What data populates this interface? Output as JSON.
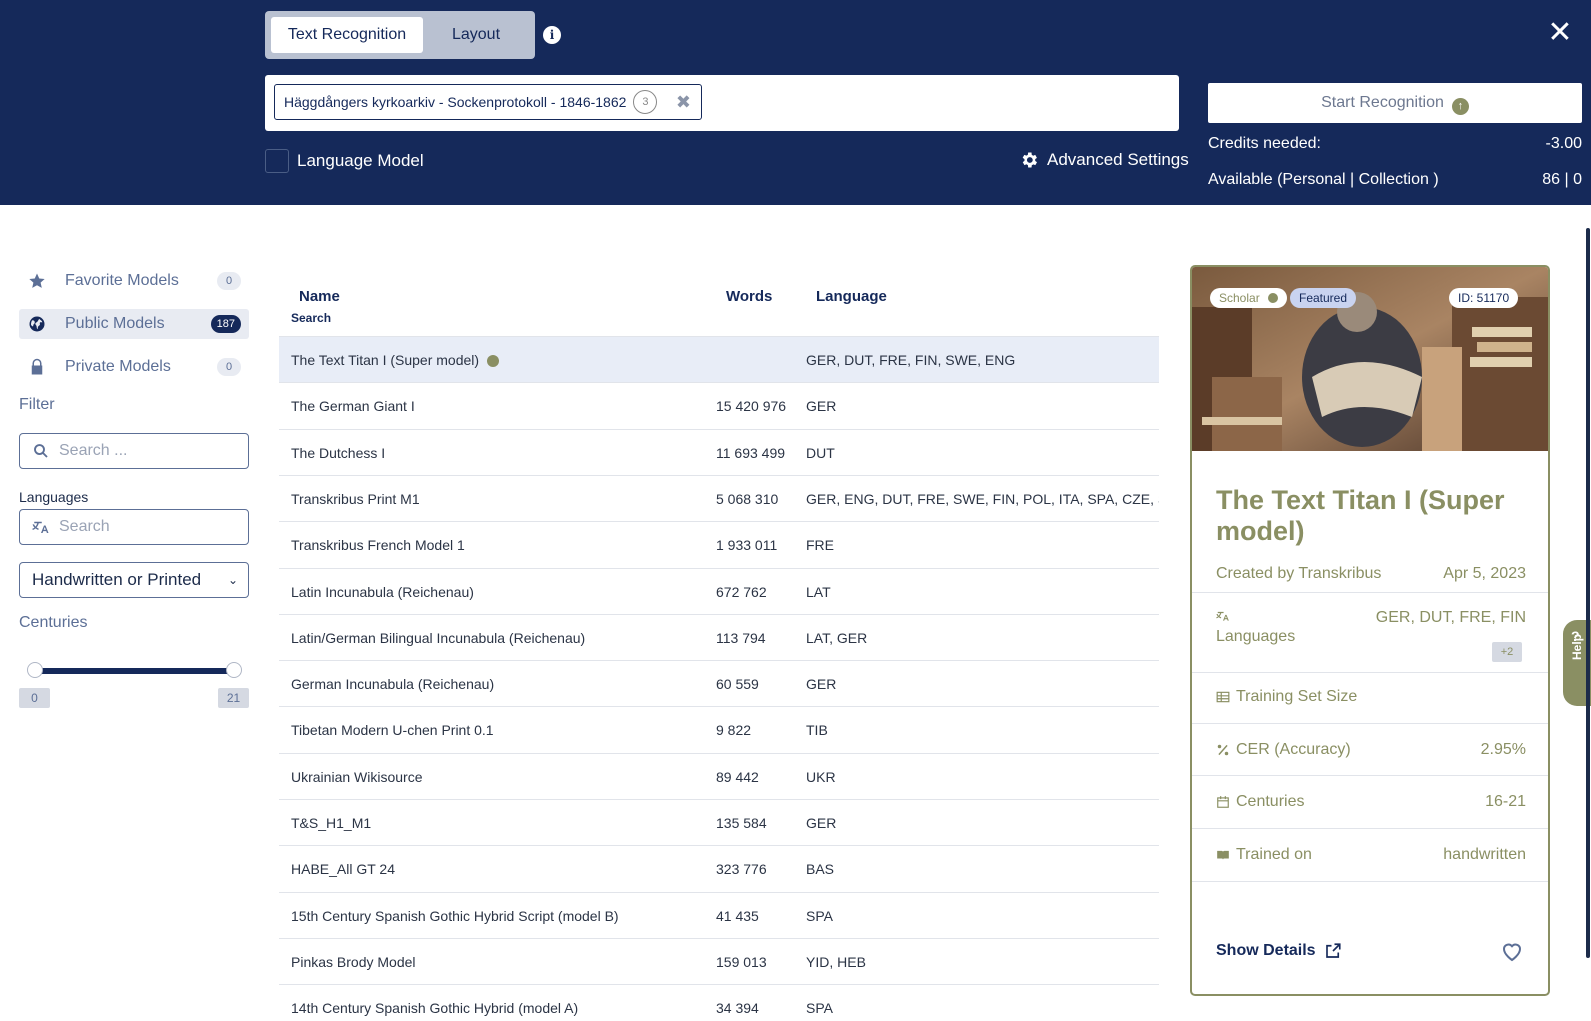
{
  "header": {
    "tabs": [
      {
        "label": "Text Recognition",
        "active": true
      },
      {
        "label": "Layout",
        "active": false
      }
    ],
    "document": {
      "name": "Häggdångers kyrkoarkiv - Sockenprotokoll - 1846-1862",
      "count": "3"
    },
    "language_model_label": "Language Model",
    "advanced_settings_label": "Advanced Settings",
    "start_label": "Start Recognition",
    "credits": {
      "needed_label": "Credits needed:",
      "needed_value": "-3.00",
      "available_label": "Available (Personal | Collection )",
      "available_value": "86 | 0"
    }
  },
  "sidebar": {
    "items": [
      {
        "label": "Favorite Models",
        "count": "0",
        "icon": "star-icon"
      },
      {
        "label": "Public Models",
        "count": "187",
        "icon": "globe-icon"
      },
      {
        "label": "Private Models",
        "count": "0",
        "icon": "lock-icon"
      }
    ],
    "filter_label": "Filter",
    "search_placeholder": "Search ...",
    "languages_label": "Languages",
    "languages_placeholder": "Search",
    "type_select": "Handwritten or Printed",
    "centuries_label": "Centuries",
    "centuries_range": {
      "min": "0",
      "max": "21"
    }
  },
  "table": {
    "headers": {
      "name": "Name",
      "name_sub": "Search",
      "words": "Words",
      "language": "Language"
    },
    "rows": [
      {
        "name": "The Text Titan I (Super model)",
        "words": "",
        "lang": "GER, DUT, FRE, FIN, SWE, ENG"
      },
      {
        "name": "The German Giant I",
        "words": "15 420 976",
        "lang": "GER"
      },
      {
        "name": "The Dutchess I",
        "words": "11 693 499",
        "lang": "DUT"
      },
      {
        "name": "Transkribus Print M1",
        "words": "5 068 310",
        "lang": "GER, ENG, DUT, FRE, SWE, FIN, POL, ITA, SPA, CZE, SLO, SL"
      },
      {
        "name": "Transkribus French Model 1",
        "words": "1 933 011",
        "lang": "FRE"
      },
      {
        "name": "Latin Incunabula (Reichenau)",
        "words": "672 762",
        "lang": "LAT"
      },
      {
        "name": "Latin/German Bilingual Incunabula (Reichenau)",
        "words": "113 794",
        "lang": "LAT, GER"
      },
      {
        "name": "German Incunabula (Reichenau)",
        "words": "60 559",
        "lang": "GER"
      },
      {
        "name": "Tibetan Modern U-chen Print 0.1",
        "words": "9 822",
        "lang": "TIB"
      },
      {
        "name": "Ukrainian Wikisource",
        "words": "89 442",
        "lang": "UKR"
      },
      {
        "name": "T&S_H1_M1",
        "words": "135 584",
        "lang": "GER"
      },
      {
        "name": "HABE_All GT 24",
        "words": "323 776",
        "lang": "BAS"
      },
      {
        "name": "15th Century Spanish Gothic Hybrid Script (model B)",
        "words": "41 435",
        "lang": "SPA"
      },
      {
        "name": "Pinkas Brody Model",
        "words": "159 013",
        "lang": "YID, HEB"
      },
      {
        "name": "14th Century Spanish Gothic Hybrid (model A)",
        "words": "34 394",
        "lang": "SPA"
      }
    ]
  },
  "card": {
    "badge_scholar": "Scholar",
    "badge_featured": "Featured",
    "id": "ID: 51170",
    "title": "The Text Titan I (Super model)",
    "created_by": "Created by Transkribus",
    "date": "Apr 5, 2023",
    "languages_label": "Languages",
    "languages_value": "GER, DUT, FRE, FIN",
    "languages_more": "+2",
    "training_label": "Training Set Size",
    "cer_label": "CER (Accuracy)",
    "cer_value": "2.95%",
    "centuries_label": "Centuries",
    "centuries_value": "16-21",
    "trained_label": "Trained on",
    "trained_value": "handwritten",
    "show_details": "Show Details"
  },
  "help_label": "Help",
  "colors": {
    "navy": "#15295a",
    "olive": "#8a8f63",
    "muted": "#5c6f96"
  }
}
